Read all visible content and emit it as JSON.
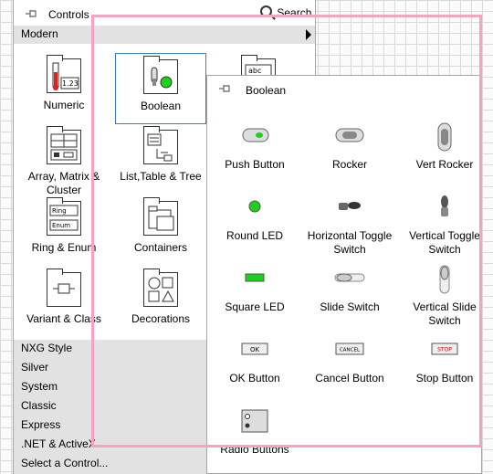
{
  "controls": {
    "title": "Controls",
    "search_label": "Search",
    "palette": "Modern",
    "categories": [
      "Numeric",
      "Boolean",
      "Array, Matrix & Cluster",
      "List,Table & Tree",
      "Ring & Enum",
      "Containers",
      "Variant & Class",
      "Decorations"
    ],
    "icon_text": {
      "numeric": "1.23",
      "ring": "Ring",
      "enum": "Enum",
      "string": "abc"
    },
    "other_palettes": [
      "NXG Style",
      "Silver",
      "System",
      "Classic",
      "Express",
      ".NET & ActiveX",
      "Select a Control..."
    ]
  },
  "boolean": {
    "title": "Boolean",
    "items": [
      "Push Button",
      "Rocker",
      "Vert Rocker",
      "Round LED",
      "Horizontal Toggle Switch",
      "Vertical Toggle Switch",
      "Square LED",
      "Slide Switch",
      "Vertical Slide Switch",
      "OK Button",
      "Cancel Button",
      "Stop Button",
      "Radio Buttons"
    ],
    "icon_text": {
      "ok": "OK",
      "cancel": "CANCEL",
      "stop": "STOP"
    }
  },
  "colors": {
    "highlight": "#f4a3c0",
    "led_green": "#1bd11b",
    "selection": "#3c7fb1",
    "stop_red": "#cc0000"
  }
}
